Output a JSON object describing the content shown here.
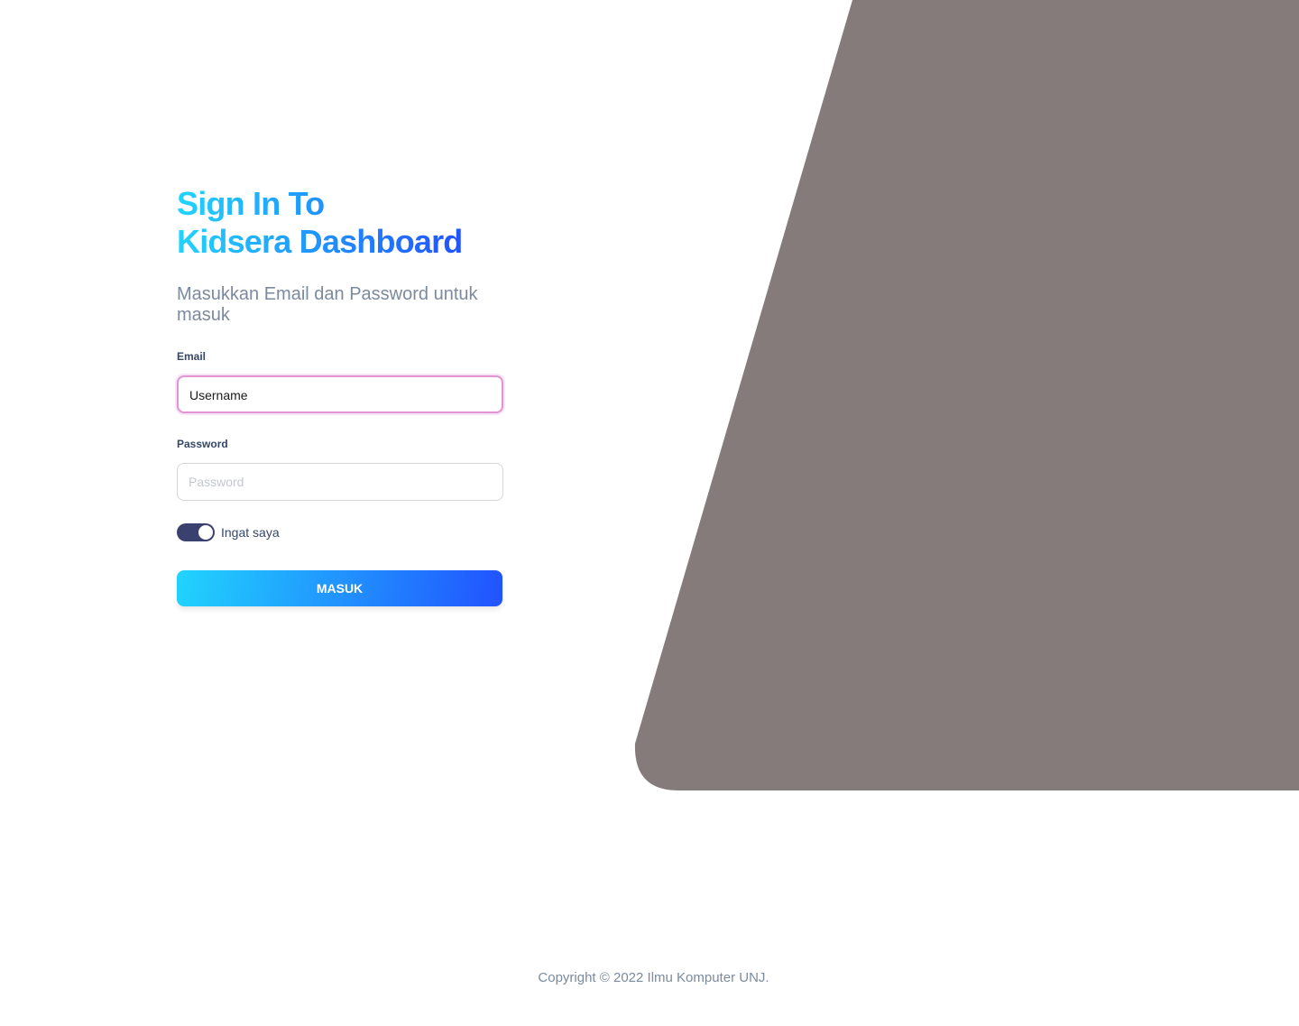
{
  "colors": {
    "accent_start": "#21d4fd",
    "accent_end": "#2152ff",
    "panel": "#857b7a",
    "toggle_on": "#3a416f",
    "focus_border": "#e293d3"
  },
  "login": {
    "title_line1": "Sign In To",
    "title_line2": "Kidsera Dashboard",
    "subtitle": "Masukkan Email dan Password untuk masuk",
    "email_label": "Email",
    "email_value": "Username",
    "password_label": "Password",
    "password_placeholder": "Password",
    "remember_label": "Ingat saya",
    "remember_checked": true,
    "submit_label": "MASUK"
  },
  "footer": {
    "copyright": "Copyright © 2022 Ilmu Komputer UNJ."
  }
}
